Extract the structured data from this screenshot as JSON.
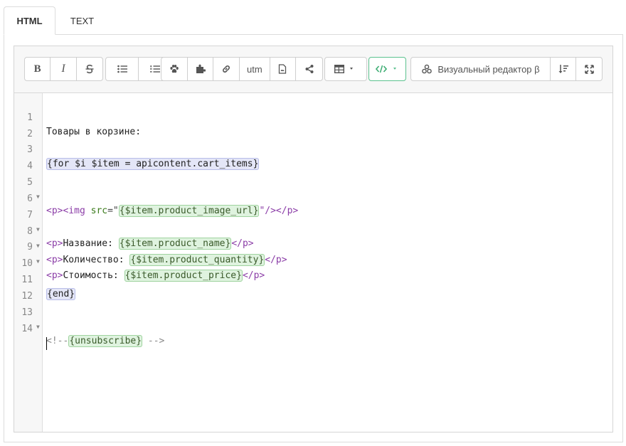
{
  "tabs": [
    {
      "label": "HTML",
      "active": true
    },
    {
      "label": "TEXT",
      "active": false
    }
  ],
  "toolbar": {
    "bold_label": "B",
    "italic_label": "I",
    "utm_label": "utm",
    "visual_editor_label": "Визуальный редактор β",
    "icons": [
      "bold-icon",
      "italic-icon",
      "strikethrough-icon",
      "bulleted-list-icon",
      "numbered-list-icon",
      "paw-icon",
      "puzzle-icon",
      "link-icon",
      "utm",
      "document-icon",
      "share-icon",
      "table-icon",
      "code-icon",
      "visual-editor-icon",
      "sort-icon",
      "fullscreen-icon"
    ],
    "accent_color": "#5cc28f"
  },
  "code": {
    "line_numbers": [
      "1",
      "2",
      "3",
      "4",
      "5",
      "6",
      "7",
      "8",
      "9",
      "10",
      "11",
      "12",
      "13",
      "14"
    ],
    "l1": "Товары в корзине:",
    "l3": "{for $i $item = apicontent.cart_items}",
    "l5_open": "<p><img ",
    "l5_attr": "src",
    "l5_eq": "=\"",
    "l5_var": "{$item.product_image_url}",
    "l5_close": "\"/></p>",
    "p_open": "<p>",
    "p_close": "</p>",
    "l7_text": "Название: ",
    "l7_var": "{$item.product_name}",
    "l8_text": "Количество: ",
    "l8_var": "{$item.product_quantity}",
    "l9_text": "Стоимость: ",
    "l9_var": "{$item.product_price}",
    "l11": "{end}",
    "l13_open": "<!--",
    "l13_var": "{unsubscribe}",
    "l13_close": " -->"
  }
}
